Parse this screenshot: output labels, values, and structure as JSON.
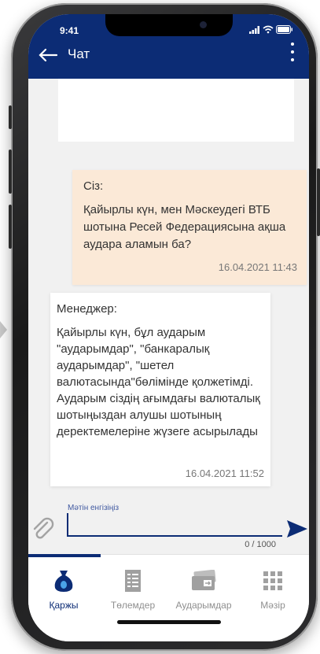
{
  "status_bar": {
    "time": "9:41"
  },
  "header": {
    "title": "Чат"
  },
  "messages": [
    {
      "sender": "Сіз:",
      "text": "Қайырлы күн, мен Мәскеудегі ВТБ шотына Ресей Федерациясына ақша аудара аламын ба?",
      "timestamp": "16.04.2021 11:43",
      "direction": "incoming"
    },
    {
      "sender": "Менеджер:",
      "text": "Қайырлы күн, бұл аударым \"аударымдар\", \"банкаралық аударымдар\", \"шетел валютасында\"бөлімінде қолжетімді. Аударым сіздің ағымдағы валюталық шотыңыздан алушы шотының деректемелеріне жүзеге асырылады",
      "timestamp": "16.04.2021 11:52",
      "direction": "outgoing"
    }
  ],
  "composer": {
    "label": "Мәтін енгізіңіз",
    "value": "",
    "counter": "0 / 1000"
  },
  "tabs": [
    {
      "label": "Қаржы",
      "icon": "money-bag-icon",
      "active": true
    },
    {
      "label": "Төлемдер",
      "icon": "payments-icon",
      "active": false
    },
    {
      "label": "Аударымдар",
      "icon": "transfer-card-icon",
      "active": false
    },
    {
      "label": "Мәзір",
      "icon": "grid-menu-icon",
      "active": false
    }
  ],
  "colors": {
    "primary": "#0c2c75",
    "incoming_bubble": "#fbe9d7",
    "outgoing_bubble": "#ffffff",
    "background": "#f1f1f1",
    "tab_inactive": "#8f8f8f"
  }
}
